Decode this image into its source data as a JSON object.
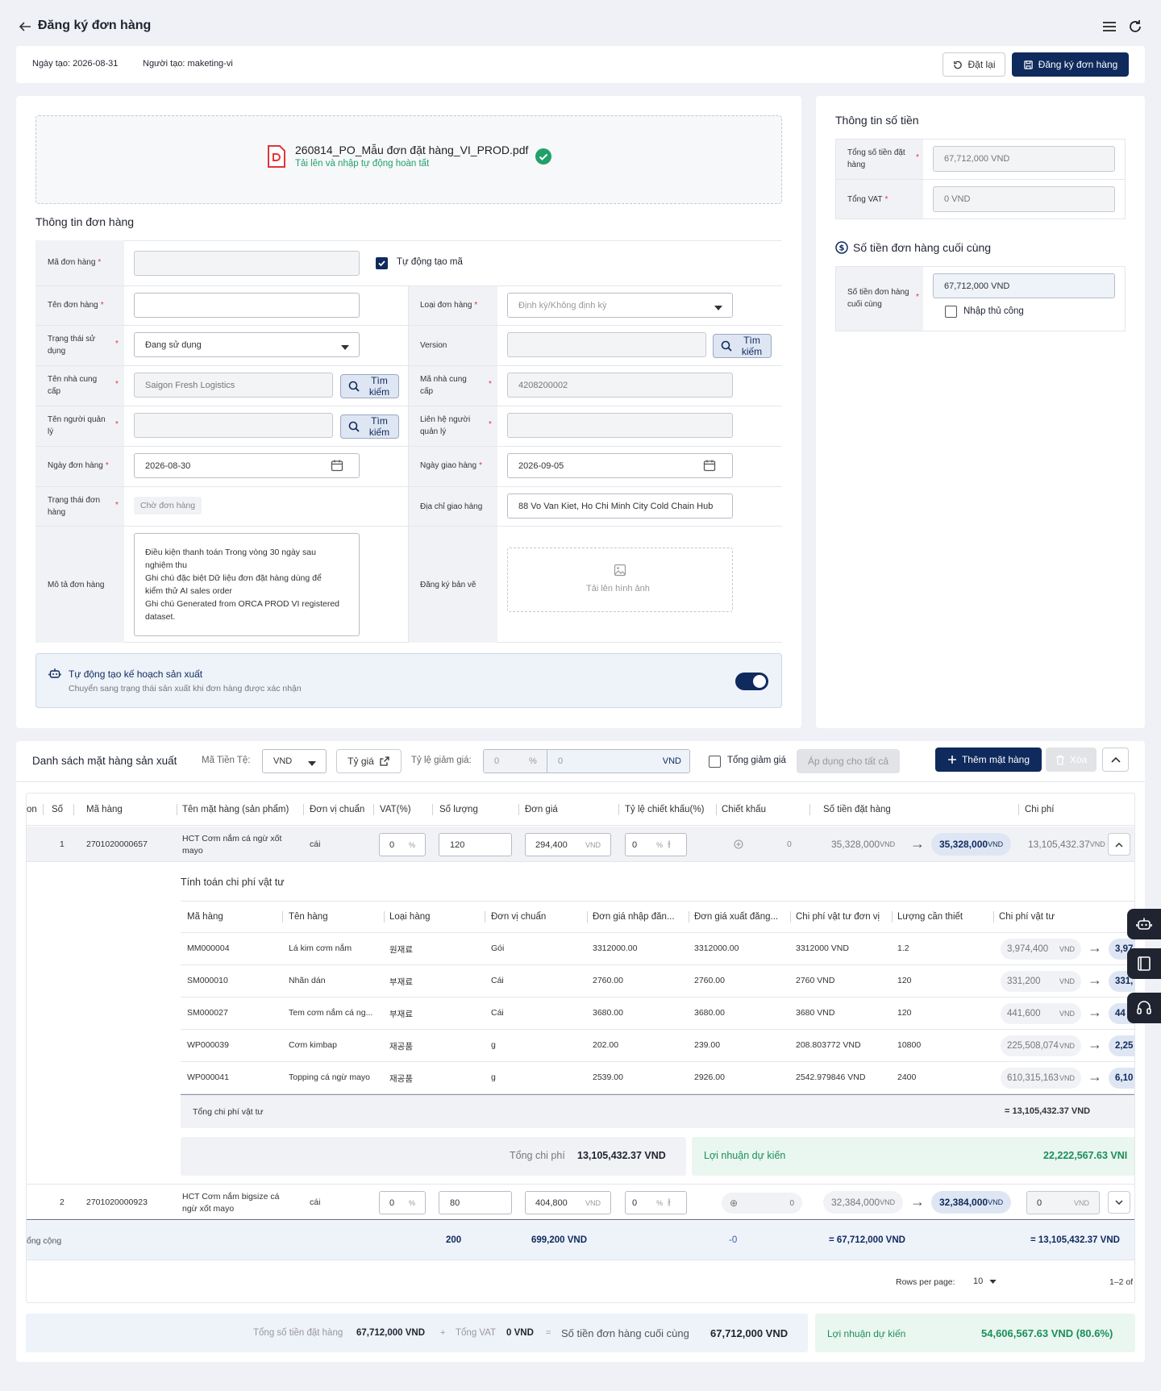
{
  "header": {
    "title": "Đăng ký đơn hàng"
  },
  "meta_bar": {
    "created_date": "Ngày tạo: 2026-08-31",
    "creator": "Người tạo: maketing-vi",
    "reset_label": "Đặt lại",
    "submit_label": "Đăng ký đơn hàng"
  },
  "upload": {
    "filename": "260814_PO_Mẫu đơn đặt hàng_VI_PROD.pdf",
    "status": "Tải lên và nhập tự động hoàn tất"
  },
  "order_info": {
    "title": "Thông tin đơn hàng",
    "order_code_label": "Mã đơn hàng",
    "order_code_value": "",
    "auto_code_label": "Tự động tạo mã",
    "order_name_label": "Tên đơn hàng",
    "order_name_value": "",
    "order_type_label": "Loại đơn hàng",
    "order_type_placeholder": "Định kỳ/Không định kỳ",
    "usage_status_label": "Trạng thái sử dụng",
    "usage_status_value": "Đang sử dụng",
    "version_label": "Version",
    "version_value": "",
    "search_label": "Tìm kiếm",
    "supplier_name_label": "Tên nhà cung cấp",
    "supplier_name_value": "Saigon Fresh Logistics",
    "supplier_code_label": "Mã nhà cung cấp",
    "supplier_code_value": "4208200002",
    "manager_name_label": "Tên người quản lý",
    "manager_name_value": "",
    "manager_contact_label": "Liên hệ người quản lý",
    "manager_contact_value": "",
    "order_date_label": "Ngày đơn hàng",
    "order_date_value": "2026-08-30",
    "delivery_date_label": "Ngày giao hàng",
    "delivery_date_value": "2026-09-05",
    "order_status_label": "Trạng thái đơn hàng",
    "order_status_value": "Chờ đơn hàng",
    "delivery_address_label": "Địa chỉ giao hàng",
    "delivery_address_value": "88 Vo Van Kiet, Ho Chi Minh City Cold Chain Hub",
    "description_label": "Mô tả đơn hàng",
    "description_lines": [
      "Điều kiện thanh toán Trong vòng 30 ngày sau",
      "nghiệm thu",
      "Ghi chú đặc biệt Dữ liệu đơn đặt hàng dùng để",
      "kiểm thử AI sales order",
      "Ghi chú Generated from ORCA PROD VI registered",
      "dataset."
    ],
    "drawing_label": "Đăng ký bản vẽ",
    "drawing_upload": "Tải lên hình ảnh"
  },
  "auto_plan": {
    "title": "Tự động tạo kế hoạch sản xuất",
    "subtitle": "Chuyển sang trạng thái sản xuất khi đơn hàng được xác nhận",
    "enabled": true
  },
  "amount_info": {
    "title": "Thông tin số tiền",
    "total_label": "Tổng số tiền đặt hàng",
    "total_value": "67,712,000 VND",
    "vat_label": "Tổng VAT",
    "vat_value": "0 VND",
    "final_title": "Số tiền đơn hàng cuối cùng",
    "final_label": "Số tiền đơn hàng cuối cùng",
    "final_value": "67,712,000 VND",
    "manual_label": "Nhập thủ công"
  },
  "items": {
    "title": "Danh sách mặt hàng sản xuất",
    "currency_label": "Mã Tiền Tệ:",
    "currency_value": "VND",
    "rate_label": "Tỷ giá",
    "discount_rate_label": "Tỷ lệ giảm giá:",
    "discount_pct": "0",
    "pct": "%",
    "discount_amt": "0",
    "vnd": "VND",
    "total_discount_label": "Tổng giảm giá",
    "apply_all_label": "Áp dụng cho tất cả",
    "add_label": "Thêm mặt hàng",
    "delete_label": "Xóa",
    "headers": [
      "on",
      "Số",
      "Mã hàng",
      "Tên mặt hàng (sản phẩm)",
      "Đơn vị chuẩn",
      "VAT(%)",
      "Số lượng",
      "Đơn giá",
      "Tỷ lệ chiết khấu(%)",
      "Chiết khấu",
      "Số tiền đặt hàng",
      "Chi phí"
    ],
    "rows": [
      {
        "no": "1",
        "code": "2701020000657",
        "name1": "HCT Cơm nắm cá ngừ xốt",
        "name2": "mayo",
        "unit": "cái",
        "vat": "0",
        "qty": "120",
        "price": "294,400",
        "disc_rate": "0",
        "disc": "0",
        "amount_before": "35,328,000",
        "amount_after": "35,328,000",
        "cost": "13,105,432.37"
      },
      {
        "no": "2",
        "code": "2701020000923",
        "name1": "HCT Cơm nắm bigsize cá",
        "name2": "ngừ xốt mayo",
        "unit": "cái",
        "vat": "0",
        "qty": "80",
        "price": "404,800",
        "disc_rate": "0",
        "disc": "0",
        "amount_before": "32,384,000",
        "amount_after": "32,384,000",
        "cost": "0"
      }
    ],
    "material": {
      "title": "Tính toán chi phí vật tư",
      "headers": [
        "Mã hàng",
        "Tên hàng",
        "Loại hàng",
        "Đơn vị chuẩn",
        "Đơn giá nhập đăn...",
        "Đơn giá xuất đăng...",
        "Chi phí vật tư đơn vị",
        "Lượng cần thiết",
        "Chi phí vật tư"
      ],
      "rows": [
        {
          "code": "MM000004",
          "name": "Lá kim cơm nắm",
          "type": "원재료",
          "unit": "Gói",
          "in_price": "3312000.00",
          "out_price": "3312000.00",
          "unit_cost": "3312000 VND",
          "qty": "1.2",
          "cost": "3,974,400",
          "cost2": "3,97"
        },
        {
          "code": "SM000010",
          "name": "Nhãn dán",
          "type": "부재료",
          "unit": "Cái",
          "in_price": "2760.00",
          "out_price": "2760.00",
          "unit_cost": "2760 VND",
          "qty": "120",
          "cost": "331,200",
          "cost2": "331,"
        },
        {
          "code": "SM000027",
          "name": "Tem cơm nắm cá ng...",
          "type": "부재료",
          "unit": "Cái",
          "in_price": "3680.00",
          "out_price": "3680.00",
          "unit_cost": "3680 VND",
          "qty": "120",
          "cost": "441,600",
          "cost2": "44"
        },
        {
          "code": "WP000039",
          "name": "Cơm kimbap",
          "type": "재공품",
          "unit": "g",
          "in_price": "202.00",
          "out_price": "239.00",
          "unit_cost": "208.803772 VND",
          "qty": "10800",
          "cost": "225,508,074",
          "cost2": "2,25"
        },
        {
          "code": "WP000041",
          "name": "Topping cá ngừ mayo",
          "type": "재공품",
          "unit": "g",
          "in_price": "2539.00",
          "out_price": "2926.00",
          "unit_cost": "2542.979846 VND",
          "qty": "2400",
          "cost": "610,315,163",
          "cost2": "6,10"
        }
      ],
      "total_label": "Tổng chi phí vật tư",
      "total_value": "= 13,105,432.37 VND",
      "total_cost_label": "Tổng chi phí",
      "total_cost_value": "13,105,432.37 VND",
      "profit_label": "Lợi nhuận dự kiến",
      "profit_value": "22,222,567.63 VNI"
    },
    "footer": {
      "label": "ổng cộng",
      "qty": "200",
      "price": "699,200 VND",
      "disc": "-0",
      "amount": "= 67,712,000 VND",
      "cost": "= 13,105,432.37 VND"
    },
    "pagination": {
      "rows_label": "Rows per page:",
      "rows_value": "10",
      "range": "1–2 of"
    }
  },
  "summary": {
    "total_label": "Tổng số tiền đặt hàng",
    "total_value": "67,712,000 VND",
    "plus": "+",
    "vat_label": "Tổng VAT",
    "vat_value": "0 VND",
    "eq": "=",
    "final_label": "Số tiền đơn hàng cuối cùng",
    "final_value": "67,712,000 VND",
    "profit_label": "Lợi nhuận dự kiến",
    "profit_value": "54,606,567.63 VND (80.6%)"
  },
  "colors": {
    "primary": "#0f2a5c",
    "success": "#22a06b",
    "profit": "#1a8f5a",
    "danger": "#e0353a"
  }
}
